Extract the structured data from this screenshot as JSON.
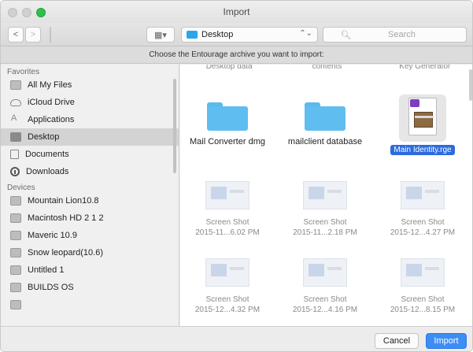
{
  "window": {
    "title": "Import"
  },
  "toolbar": {
    "back_label": "<",
    "forward_label": ">",
    "view_modes": [
      "▦",
      "≡",
      "▥",
      "▭"
    ],
    "arrange_label": "▦▾",
    "location": "Desktop",
    "location_stepper": "⌃⌄",
    "search_placeholder": "Search"
  },
  "prompt": {
    "text": "Choose the Entourage archive you want to import:"
  },
  "sidebar": {
    "favorites_label": "Favorites",
    "favorites": [
      {
        "label": "All My Files"
      },
      {
        "label": "iCloud Drive"
      },
      {
        "label": "Applications"
      },
      {
        "label": "Desktop"
      },
      {
        "label": "Documents"
      },
      {
        "label": "Downloads"
      }
    ],
    "devices_label": "Devices",
    "devices": [
      {
        "label": "Mountain Lion10.8"
      },
      {
        "label": "Macintosh HD 2 1 2"
      },
      {
        "label": "Maveric 10.9"
      },
      {
        "label": "Snow leopard(10.6)"
      },
      {
        "label": "Untitled 1"
      },
      {
        "label": "BUILDS OS"
      }
    ]
  },
  "grid": {
    "partial_top": [
      "Desktop data",
      "contents",
      "Key Generator"
    ],
    "items": [
      {
        "name": "Mail Converter dmg"
      },
      {
        "name": "mailclient database"
      },
      {
        "name": "Main Identity.rge"
      }
    ],
    "screenshots_row1": [
      {
        "line1": "Screen Shot",
        "line2": "2015-11...6.02 PM"
      },
      {
        "line1": "Screen Shot",
        "line2": "2015-11...2.18 PM"
      },
      {
        "line1": "Screen Shot",
        "line2": "2015-12...4.27 PM"
      }
    ],
    "screenshots_row2": [
      {
        "line1": "Screen Shot",
        "line2": "2015-12...4.32 PM"
      },
      {
        "line1": "Screen Shot",
        "line2": "2015-12...4.16 PM"
      },
      {
        "line1": "Screen Shot",
        "line2": "2015-12...8.15 PM"
      }
    ]
  },
  "footer": {
    "cancel_label": "Cancel",
    "import_label": "Import"
  },
  "colors": {
    "accent": "#3c8ef6",
    "folder": "#60bdf0",
    "selection": "#2b6be0"
  }
}
